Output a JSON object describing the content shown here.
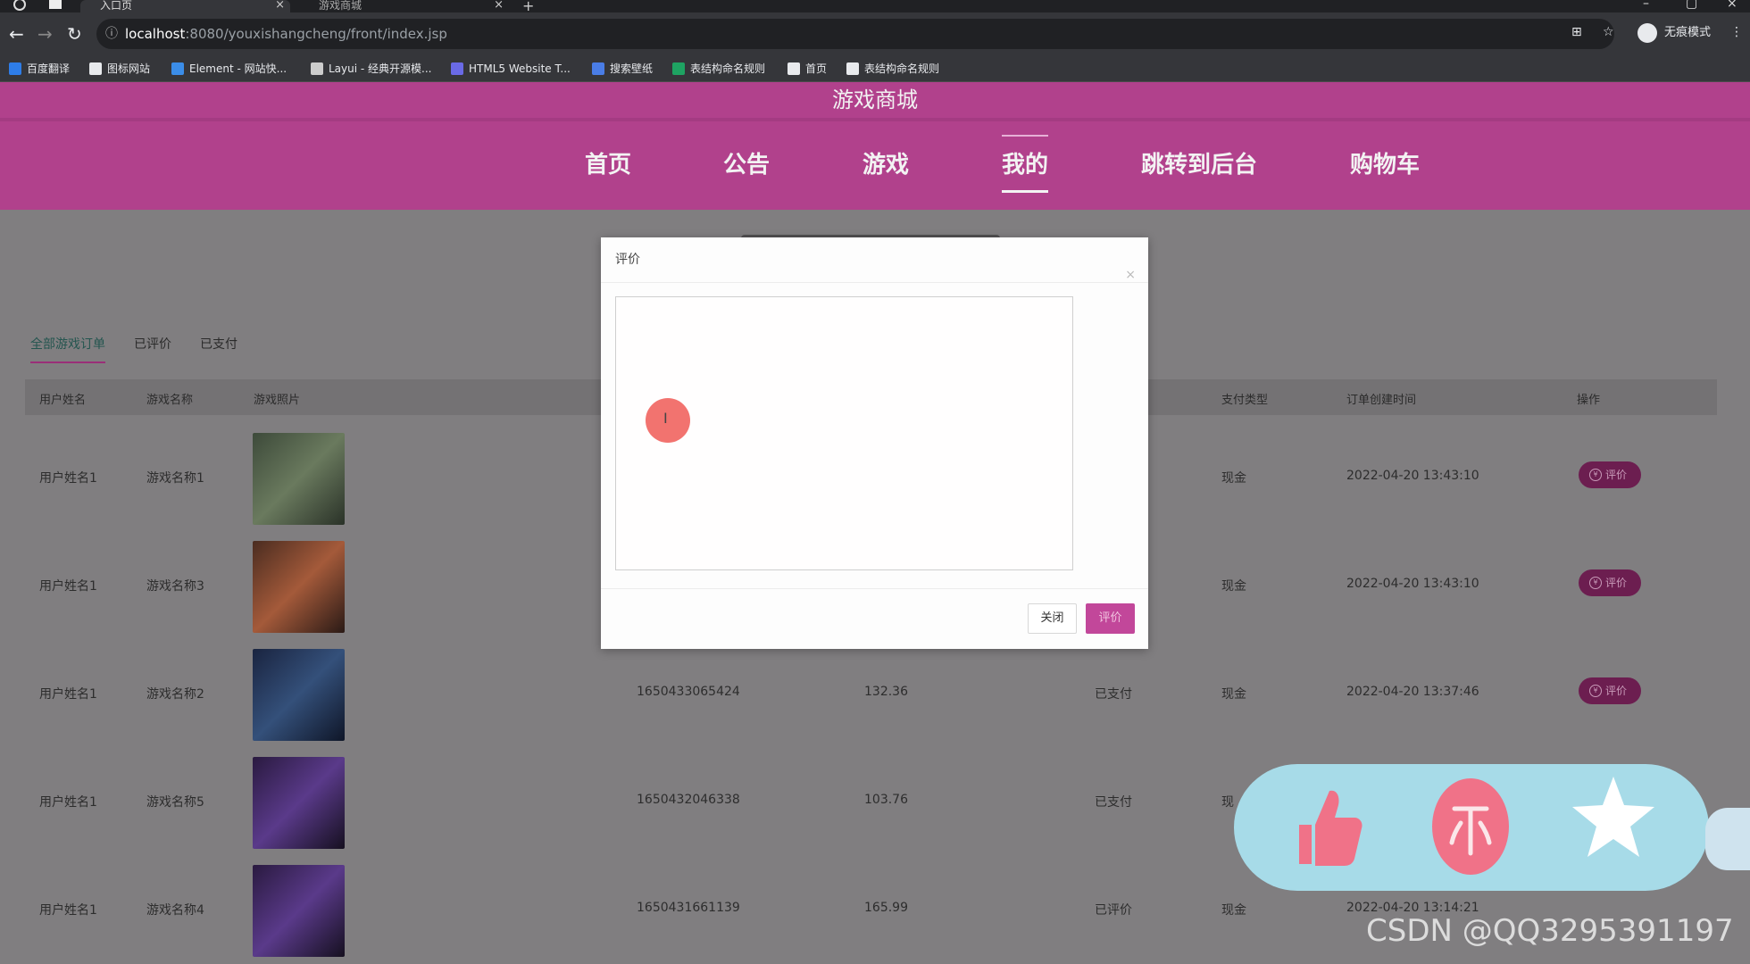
{
  "browser": {
    "tabs": [
      {
        "title": "入口页"
      },
      {
        "title": "游戏商城"
      }
    ],
    "url": {
      "host": "localhost",
      "rest": ":8080/youxishangcheng/front/index.jsp"
    },
    "profile_label": "无痕模式",
    "bookmarks": [
      {
        "label": "百度翻译",
        "color": "#2e7de8"
      },
      {
        "label": "图标网站",
        "color": "#e8eaed"
      },
      {
        "label": "Element - 网站快...",
        "color": "#3b8de8"
      },
      {
        "label": "Layui - 经典开源模...",
        "color": "#cccccc"
      },
      {
        "label": "HTML5 Website T...",
        "color": "#6a6ae6"
      },
      {
        "label": "搜索壁纸",
        "color": "#4a7de6"
      },
      {
        "label": "表结构命名规则",
        "color": "#1ea362"
      },
      {
        "label": "首页",
        "color": "#e8eaed"
      },
      {
        "label": "表结构命名规则",
        "color": "#e8eaed"
      }
    ]
  },
  "site": {
    "title": "游戏商城",
    "nav": [
      {
        "label": "首页"
      },
      {
        "label": "公告"
      },
      {
        "label": "游戏"
      },
      {
        "label": "我的",
        "active": true
      },
      {
        "label": "跳转到后台"
      },
      {
        "label": "购物车"
      }
    ],
    "accent": "#b1418c"
  },
  "orders": {
    "subtabs": [
      {
        "label": "全部游戏订单",
        "active": true
      },
      {
        "label": "已评价"
      },
      {
        "label": "已支付"
      }
    ],
    "columns": [
      "用户姓名",
      "游戏名称",
      "游戏照片",
      "支付类型",
      "订单创建时间",
      "操作"
    ],
    "rows": [
      {
        "user": "用户姓名1",
        "game": "游戏名称1",
        "order_no": "",
        "price": "",
        "status": "",
        "pay_type": "现金",
        "created": "2022-04-20 13:43:10",
        "action": "评价"
      },
      {
        "user": "用户姓名1",
        "game": "游戏名称3",
        "order_no": "",
        "price": "",
        "status": "",
        "pay_type": "现金",
        "created": "2022-04-20 13:43:10",
        "action": "评价"
      },
      {
        "user": "用户姓名1",
        "game": "游戏名称2",
        "order_no": "1650433065424",
        "price": "132.36",
        "status": "已支付",
        "pay_type": "现金",
        "created": "2022-04-20 13:37:46",
        "action": "评价"
      },
      {
        "user": "用户姓名1",
        "game": "游戏名称5",
        "order_no": "1650432046338",
        "price": "103.76",
        "status": "已支付",
        "pay_type": "现",
        "created": "",
        "action": ""
      },
      {
        "user": "用户姓名1",
        "game": "游戏名称4",
        "order_no": "1650431661139",
        "price": "165.99",
        "status": "已评价",
        "pay_type": "现金",
        "created": "2022-04-20 13:14:21",
        "action": ""
      }
    ]
  },
  "modal": {
    "title": "评价",
    "close_icon": "×",
    "textarea_value": "",
    "cancel_label": "关闭",
    "submit_label": "评价"
  },
  "floating_actions": {
    "icons": [
      "thumbs-up-icon",
      "coin-icon",
      "star-icon"
    ]
  },
  "watermark": "CSDN @QQ3295391197"
}
